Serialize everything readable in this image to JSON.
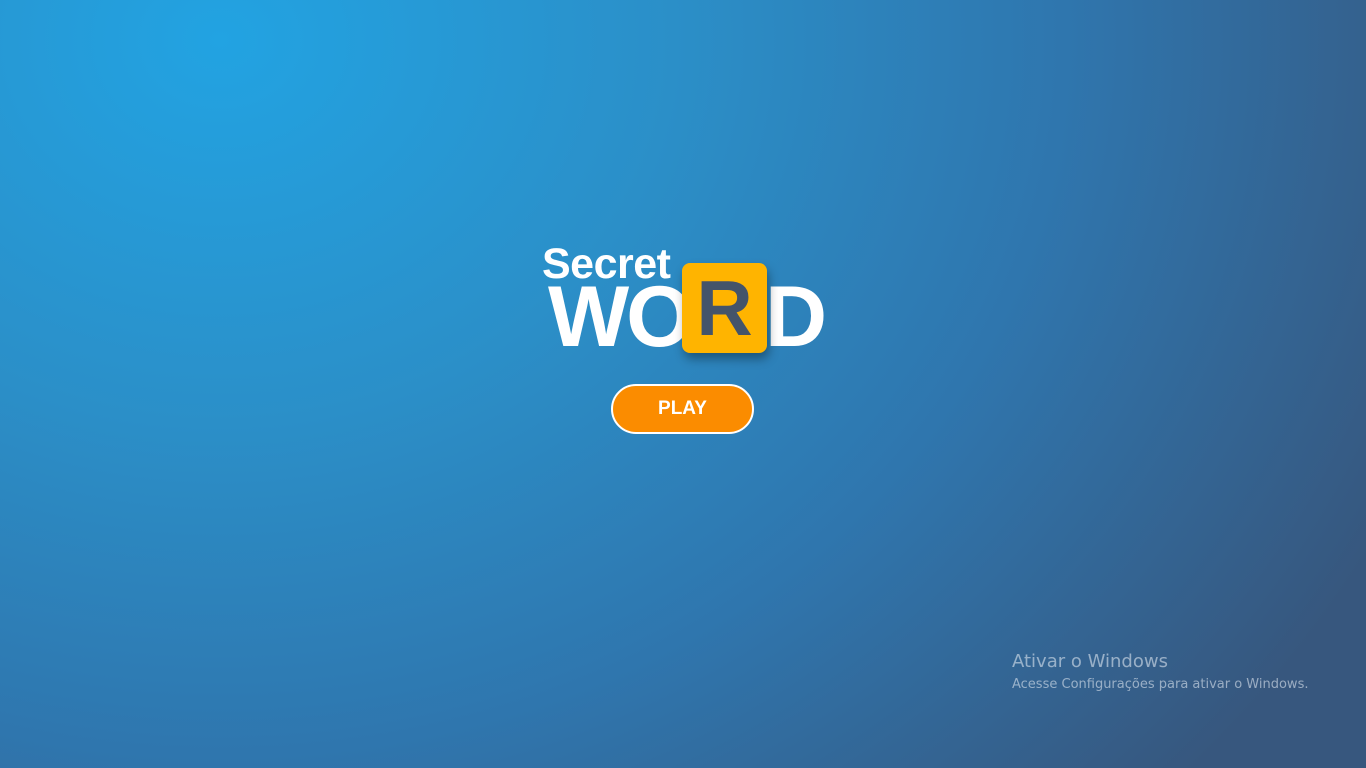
{
  "logo": {
    "top_text": "Secret",
    "word_left": "WO",
    "word_tile": "R",
    "word_right": "D",
    "tile_color": "#ffb400",
    "tile_letter_color": "#44546a"
  },
  "play_button": {
    "label": "PLAY",
    "color": "#fb8c00"
  },
  "background": {
    "gradient_start": "#22a3e2",
    "gradient_end": "#37577e"
  },
  "activation_watermark": {
    "title": "Ativar o Windows",
    "subtitle": "Acesse Configurações para ativar o Windows."
  }
}
